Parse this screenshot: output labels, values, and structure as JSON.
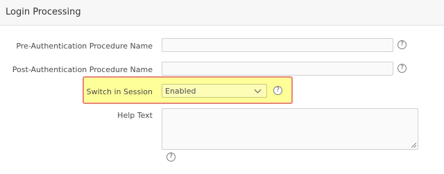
{
  "section": {
    "title": "Login Processing"
  },
  "fields": {
    "pre_auth": {
      "label": "Pre-Authentication Procedure Name",
      "value": ""
    },
    "post_auth": {
      "label": "Post-Authentication Procedure Name",
      "value": ""
    },
    "switch_in_session": {
      "label": "Switch in Session",
      "selected": "Enabled"
    },
    "help_text": {
      "label": "Help Text",
      "value": ""
    }
  },
  "icons": {
    "help": {
      "name": "help-icon",
      "glyph": "?"
    },
    "dropdown": {
      "name": "chevron-down-icon"
    }
  },
  "colors": {
    "highlight_fill": "#ffff99",
    "highlight_border": "#e8857a"
  }
}
